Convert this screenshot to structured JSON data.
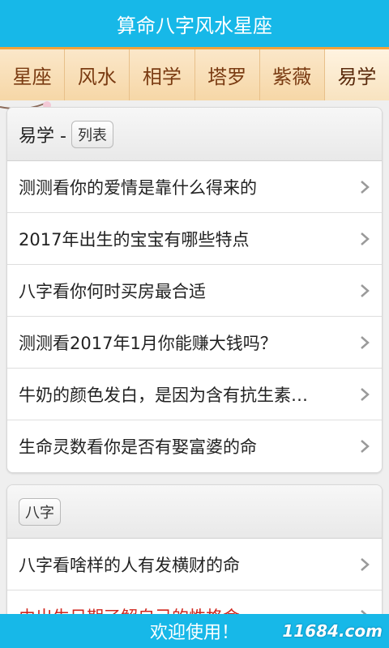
{
  "app": {
    "title": "算命八字风水星座"
  },
  "tabs": [
    {
      "label": "星座"
    },
    {
      "label": "风水"
    },
    {
      "label": "相学"
    },
    {
      "label": "塔罗"
    },
    {
      "label": "紫薇"
    },
    {
      "label": "易学",
      "active": true
    }
  ],
  "section1": {
    "title": "易学 -",
    "tag": "列表",
    "items": [
      "测测看你的爱情是靠什么得来的",
      "2017年出生的宝宝有哪些特点",
      "八字看你何时买房最合适",
      "测测看2017年1月你能赚大钱吗？",
      "牛奶的颜色发白，是因为含有抗生素…",
      "生命灵数看你是否有娶富婆的命"
    ]
  },
  "section2": {
    "tag": "八字",
    "items": [
      "八字看啥样的人有发横财的命",
      "由出生日期了解自己的性格命"
    ]
  },
  "footer": {
    "text": "欢迎使用！"
  },
  "watermark": {
    "text": "11684.com"
  },
  "colors": {
    "accent": "#17b8e8",
    "tab_border": "#f2a33a",
    "highlight_text": "#d0261d"
  },
  "icons": {
    "row_chevron": "chevron-right-icon"
  }
}
